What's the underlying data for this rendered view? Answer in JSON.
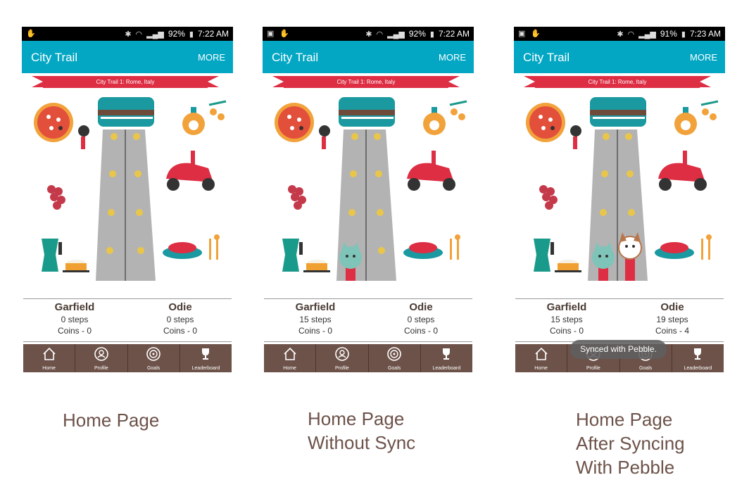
{
  "screens": [
    {
      "status_time": "7:22 AM",
      "status_battery": "92%",
      "app_title": "City Trail",
      "more_label": "MORE",
      "banner": "City Trail 1: Rome, Italy",
      "players": [
        {
          "name": "Garfield",
          "steps": "0 steps",
          "coins": "Coins - 0"
        },
        {
          "name": "Odie",
          "steps": "0 steps",
          "coins": "Coins - 0"
        }
      ],
      "nav": [
        "Home",
        "Profile",
        "Goals",
        "Leaderboard"
      ],
      "caption": "Home Page",
      "toast": ""
    },
    {
      "status_time": "7:22 AM",
      "status_battery": "92%",
      "app_title": "City Trail",
      "more_label": "MORE",
      "banner": "City Trail 1: Rome, Italy",
      "players": [
        {
          "name": "Garfield",
          "steps": "15 steps",
          "coins": "Coins - 0"
        },
        {
          "name": "Odie",
          "steps": "0 steps",
          "coins": "Coins - 0"
        }
      ],
      "nav": [
        "Home",
        "Profile",
        "Goals",
        "Leaderboard"
      ],
      "caption_line1": "Home Page",
      "caption_line2": "Without Sync",
      "toast": ""
    },
    {
      "status_time": "7:23 AM",
      "status_battery": "91%",
      "app_title": "City Trail",
      "more_label": "MORE",
      "banner": "City Trail 1: Rome, Italy",
      "players": [
        {
          "name": "Garfield",
          "steps": "15 steps",
          "coins": "Coins - 0"
        },
        {
          "name": "Odie",
          "steps": "19 steps",
          "coins": "Coins - 4"
        }
      ],
      "nav": [
        "Home",
        "Profile",
        "Goals",
        "Leaderboard"
      ],
      "caption_line1": "Home Page",
      "caption_line2": "After Syncing",
      "caption_line3": "With Pebble",
      "toast": "Synced with Pebble."
    }
  ],
  "colors": {
    "appbar": "#03a7c4",
    "nav": "#6d5249",
    "banner": "#dd2e44",
    "caption": "#6d5249",
    "tower": "#b3b3b3",
    "colosseum": "#1a9aa0"
  },
  "icons": [
    "home-icon",
    "profile-icon",
    "goals-icon",
    "leaderboard-icon",
    "bluetooth-icon",
    "wifi-icon",
    "signal-icon",
    "battery-icon"
  ]
}
